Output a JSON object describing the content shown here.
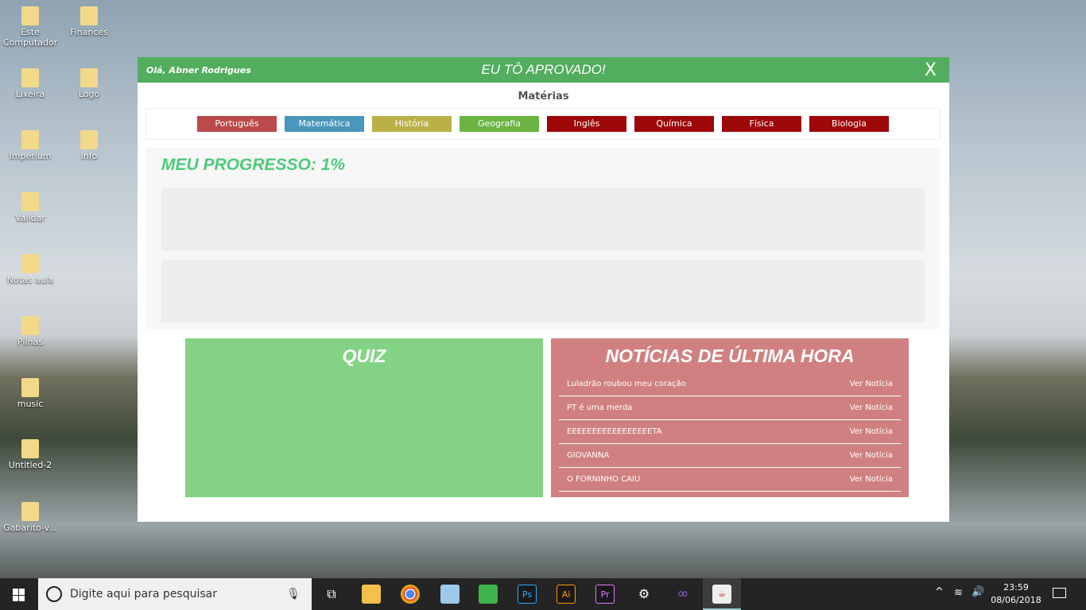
{
  "desktop": {
    "icons": [
      "Este Computador",
      "Finances",
      "Lixeira",
      "Logo",
      "Imperium",
      "info",
      "Validar",
      "Notas aula",
      "Pilhas",
      "music",
      "Untitled-2",
      "Gabarito-v..."
    ]
  },
  "window": {
    "greeting": "Olá, Abner Rodrigues",
    "title": "EU TÔ APROVADO!",
    "close": "X",
    "subjects_label": "Matérias",
    "subjects": [
      {
        "label": "Português",
        "color": "#bb4a4b"
      },
      {
        "label": "Matemática",
        "color": "#4a97bd"
      },
      {
        "label": "História",
        "color": "#bab146"
      },
      {
        "label": "Geografia",
        "color": "#6bb443"
      },
      {
        "label": "Inglês",
        "color": "#9e0707"
      },
      {
        "label": "Química",
        "color": "#9e0707"
      },
      {
        "label": "Física",
        "color": "#9e0707"
      },
      {
        "label": "Biologia",
        "color": "#9e0707"
      }
    ],
    "progress_title": "MEU PROGRESSO: 1%",
    "progress_percent": 1,
    "quiz_title": "QUIZ",
    "news_title": "NOTÍCIAS DE ÚLTIMA HORA",
    "news": [
      {
        "title": "Luladrão roubou meu coração",
        "link": "Ver Notícia"
      },
      {
        "title": "PT é uma merda",
        "link": "Ver Notícia"
      },
      {
        "title": "EEEEEEEEEEEEEEEEETA",
        "link": "Ver Notícia"
      },
      {
        "title": "GIOVANNA",
        "link": "Ver Notícia"
      },
      {
        "title": "O FORNINHO CAIU",
        "link": "Ver Notícia"
      }
    ]
  },
  "taskbar": {
    "search_placeholder": "Digite aqui para pesquisar",
    "time": "23:59",
    "date": "08/06/2018",
    "apps": [
      {
        "label": "Ps",
        "color": "#31a8ff"
      },
      {
        "label": "Ai",
        "color": "#ff9a00"
      },
      {
        "label": "Pr",
        "color": "#e479ff"
      }
    ]
  }
}
